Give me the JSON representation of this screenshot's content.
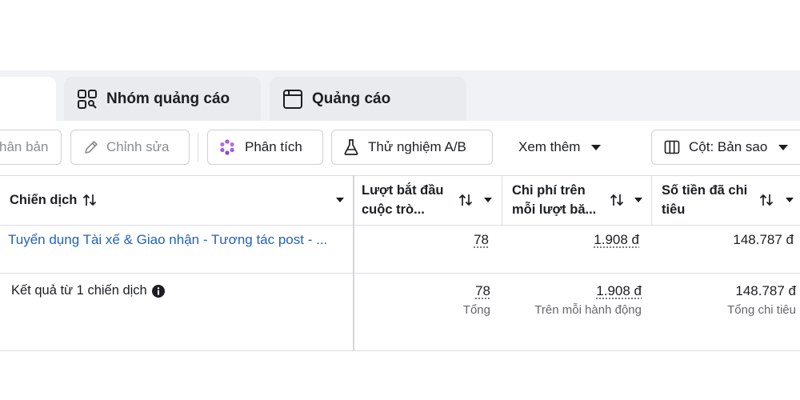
{
  "tabs": {
    "adsets_label": "Nhóm quảng cáo",
    "ads_label": "Quảng cáo"
  },
  "toolbar": {
    "duplicate_label": "hân bản",
    "edit_label": "Chỉnh sửa",
    "analyze_label": "Phân tích",
    "abtest_label": "Thử nghiệm A/B",
    "more_label": "Xem thêm",
    "columns_label": "Cột: Bản sao"
  },
  "table": {
    "headers": {
      "campaign": "Chiến dịch",
      "conversations_l1": "Lượt bắt đầu",
      "conversations_l2": "cuộc trò...",
      "cost_l1": "Chi phí trên",
      "cost_l2": "mỗi lượt bă...",
      "spent_l1": "Số tiền đã chi",
      "spent_l2": "tiêu"
    },
    "row": {
      "campaign_name": "Tuyển dụng Tài xế & Giao nhận - Tương tác post - ...",
      "conversations": "78",
      "cost_per": "1.908 đ",
      "spent": "148.787 đ"
    },
    "summary": {
      "label": "Kết quả từ 1 chiến dịch",
      "conversations": "78",
      "conversations_sub": "Tổng",
      "cost_per": "1.908 đ",
      "cost_per_sub": "Trên mỗi hành động",
      "spent": "148.787 đ",
      "spent_sub": "Tổng chi tiêu"
    }
  },
  "colors": {
    "link": "#1d63c4",
    "muted_text": "#65676b",
    "analyze_icon": "#a259e6"
  },
  "icons": {
    "adsets_tab": "ad-set-grid-icon",
    "ads_tab": "ad-window-icon",
    "edit": "pencil-icon",
    "analyze": "sparkle-flower-icon",
    "abtest": "flask-icon",
    "columns": "columns-icon",
    "sort": "sort-arrows-icon",
    "info": "info-icon"
  }
}
